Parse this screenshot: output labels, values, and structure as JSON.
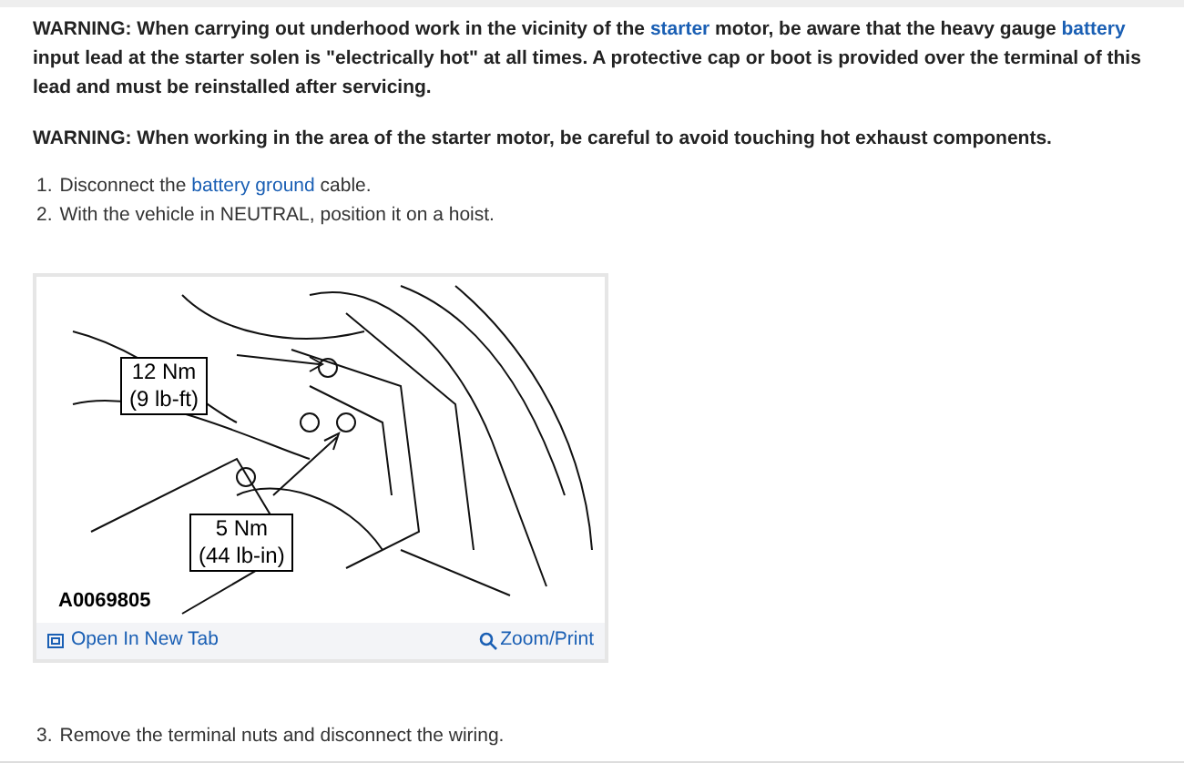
{
  "warnings": [
    {
      "segments": [
        {
          "text": "WARNING: When carrying out underhood work in the vicinity of the ",
          "link": false
        },
        {
          "text": "starter",
          "link": true
        },
        {
          "text": " motor, be aware that the heavy gauge ",
          "link": false
        },
        {
          "text": "battery",
          "link": true
        },
        {
          "text": " input lead at the starter solen is \"electrically hot\" at all times. A protective cap or boot is provided over the terminal of this lead and must be reinstalled after servicing.",
          "link": false
        }
      ]
    },
    {
      "segments": [
        {
          "text": "WARNING: When working in the area of the starter motor, be careful to avoid touching hot exhaust components.",
          "link": false
        }
      ]
    }
  ],
  "steps": [
    {
      "number": "1.",
      "segments": [
        {
          "text": "Disconnect the ",
          "link": false
        },
        {
          "text": "battery ground",
          "link": true
        },
        {
          "text": " cable.",
          "link": false
        }
      ]
    },
    {
      "number": "2.",
      "segments": [
        {
          "text": "With the vehicle in NEUTRAL, position it on a hoist.",
          "link": false
        }
      ]
    }
  ],
  "figure": {
    "callouts": [
      {
        "line1": "12 Nm",
        "line2": "(9 lb-ft)"
      },
      {
        "line1": "5 Nm",
        "line2": "(44 lb-in)"
      }
    ],
    "code": "A0069805",
    "open_link": "Open In New Tab",
    "zoom_link": "Zoom/Print"
  },
  "steps_after": [
    {
      "number": "3.",
      "segments": [
        {
          "text": "Remove the terminal nuts and disconnect the wiring.",
          "link": false
        }
      ]
    }
  ]
}
